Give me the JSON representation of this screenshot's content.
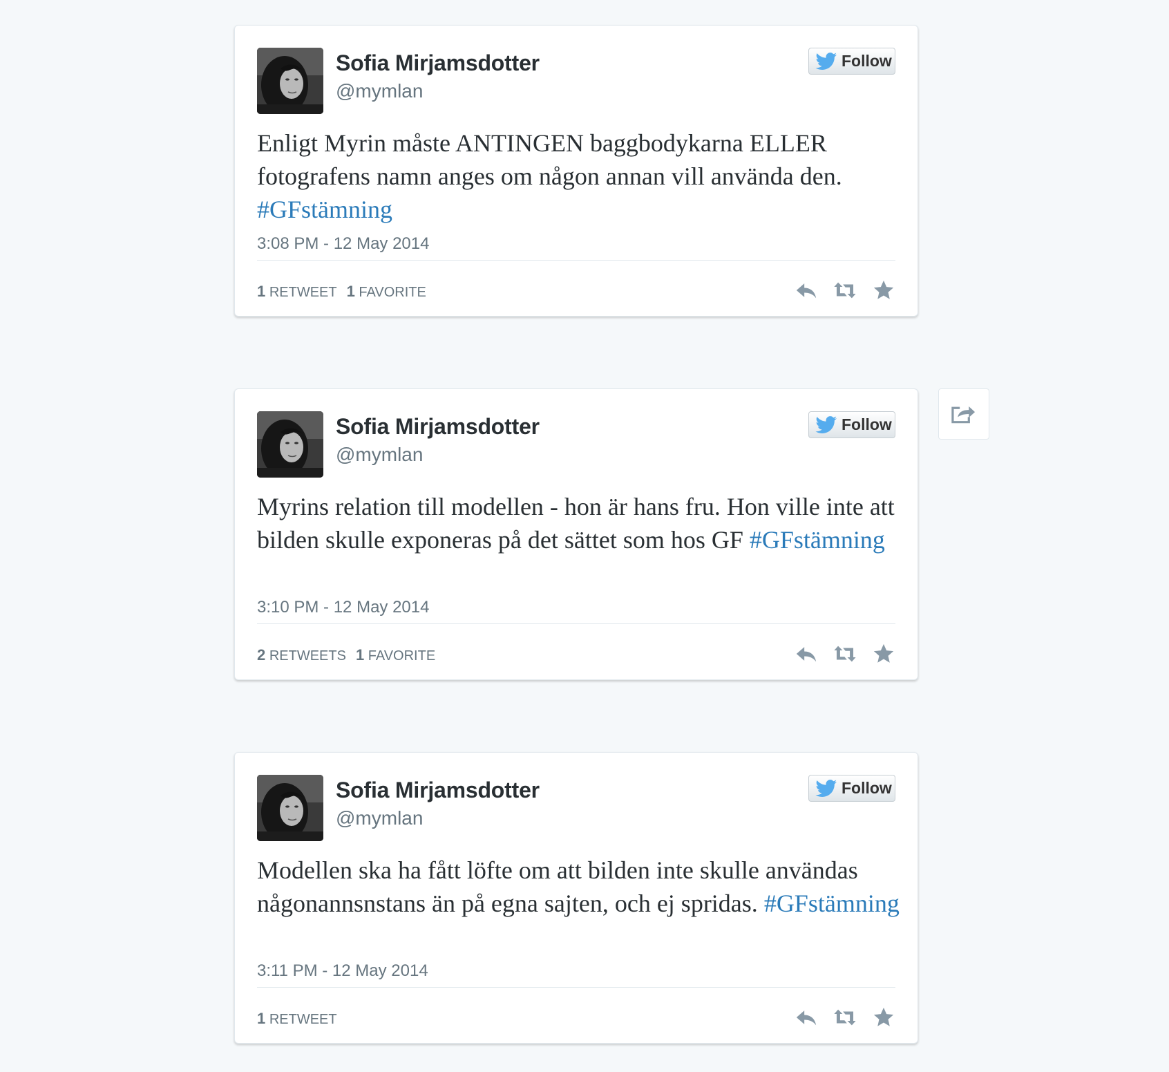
{
  "icons": {
    "follow": "twitter-bird-icon",
    "reply": "reply-icon",
    "retweet": "retweet-icon",
    "favorite": "star-icon",
    "share": "share-icon"
  },
  "colors": {
    "page_background": "#f5f8fa",
    "card_background": "#ffffff",
    "hashtag": "#2b7bb9",
    "twitter_blue": "#55acee",
    "action_icon": "#8899a6"
  },
  "tweets": [
    {
      "display_name": "Sofia Mirjamsdotter",
      "handle": "@mymlan",
      "follow_label": "Follow",
      "text": "Enligt Myrin måste ANTINGEN baggbodykarna ELLER fotografens namn anges om någon annan vill använda den. ",
      "hashtag": "#GFstämning",
      "timestamp": "3:08 PM - 12 May 2014",
      "stats": [
        {
          "count": "1",
          "label": "RETWEET"
        },
        {
          "count": "1",
          "label": "FAVORITE"
        }
      ]
    },
    {
      "display_name": "Sofia Mirjamsdotter",
      "handle": "@mymlan",
      "follow_label": "Follow",
      "text": "Myrins relation till modellen - hon är hans fru. Hon ville inte att bilden skulle exponeras på det sättet som hos GF ",
      "hashtag": "#GFstämning",
      "timestamp": "3:10 PM - 12 May 2014",
      "stats": [
        {
          "count": "2",
          "label": "RETWEETS"
        },
        {
          "count": "1",
          "label": "FAVORITE"
        }
      ]
    },
    {
      "display_name": "Sofia Mirjamsdotter",
      "handle": "@mymlan",
      "follow_label": "Follow",
      "text": "Modellen ska ha fått löfte om att bilden inte skulle användas någonannsnstans än på egna sajten, och ej spridas. ",
      "hashtag": "#GFstämning",
      "timestamp": "3:11 PM - 12 May 2014",
      "stats": [
        {
          "count": "1",
          "label": "RETWEET"
        }
      ]
    }
  ]
}
